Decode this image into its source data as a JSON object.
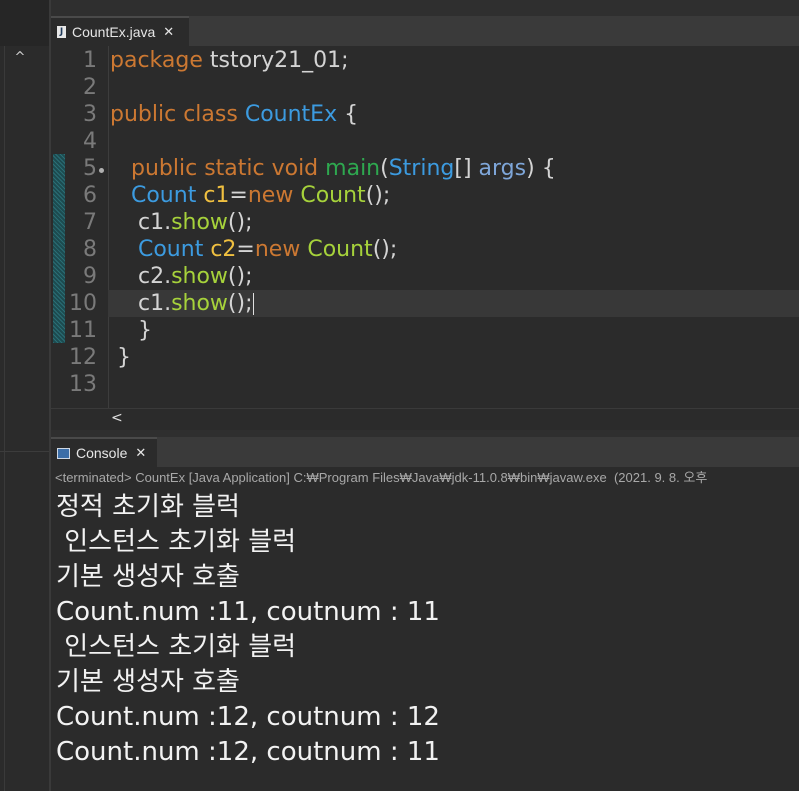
{
  "editor": {
    "tab_label": "CountEx.java",
    "file_icon": "java-file-icon",
    "close_glyph": "✕",
    "lines": [
      {
        "num": "1",
        "tokens": [
          {
            "t": "package",
            "c": "kw"
          },
          {
            "t": " tstory21_01;",
            "c": "pl"
          }
        ]
      },
      {
        "num": "2",
        "tokens": []
      },
      {
        "num": "3",
        "tokens": [
          {
            "t": "public",
            "c": "kw"
          },
          {
            "t": " ",
            "c": "pl"
          },
          {
            "t": "class",
            "c": "kw"
          },
          {
            "t": " ",
            "c": "pl"
          },
          {
            "t": "CountEx",
            "c": "cls"
          },
          {
            "t": " {",
            "c": "pl"
          }
        ]
      },
      {
        "num": "4",
        "tokens": []
      },
      {
        "num": "5",
        "tokens": [
          {
            "t": "   ",
            "c": "pl"
          },
          {
            "t": "public",
            "c": "kw"
          },
          {
            "t": " ",
            "c": "pl"
          },
          {
            "t": "static",
            "c": "kw"
          },
          {
            "t": " ",
            "c": "pl"
          },
          {
            "t": "void",
            "c": "kw"
          },
          {
            "t": " ",
            "c": "pl"
          },
          {
            "t": "main",
            "c": "fn"
          },
          {
            "t": "(",
            "c": "pl"
          },
          {
            "t": "String",
            "c": "cls"
          },
          {
            "t": "[] ",
            "c": "pl"
          },
          {
            "t": "args",
            "c": "arg"
          },
          {
            "t": ") {",
            "c": "pl"
          }
        ]
      },
      {
        "num": "6",
        "tokens": [
          {
            "t": "   ",
            "c": "pl"
          },
          {
            "t": "Count",
            "c": "cls"
          },
          {
            "t": " ",
            "c": "pl"
          },
          {
            "t": "c1",
            "c": "var"
          },
          {
            "t": "=",
            "c": "pl"
          },
          {
            "t": "new",
            "c": "kw"
          },
          {
            "t": " ",
            "c": "pl"
          },
          {
            "t": "Count",
            "c": "mth"
          },
          {
            "t": "();",
            "c": "pl"
          }
        ]
      },
      {
        "num": "7",
        "tokens": [
          {
            "t": "    c1.",
            "c": "pl"
          },
          {
            "t": "show",
            "c": "mth"
          },
          {
            "t": "();",
            "c": "pl"
          }
        ]
      },
      {
        "num": "8",
        "tokens": [
          {
            "t": "    ",
            "c": "pl"
          },
          {
            "t": "Count",
            "c": "cls"
          },
          {
            "t": " ",
            "c": "pl"
          },
          {
            "t": "c2",
            "c": "var"
          },
          {
            "t": "=",
            "c": "pl"
          },
          {
            "t": "new",
            "c": "kw"
          },
          {
            "t": " ",
            "c": "pl"
          },
          {
            "t": "Count",
            "c": "mth"
          },
          {
            "t": "();",
            "c": "pl"
          }
        ]
      },
      {
        "num": "9",
        "tokens": [
          {
            "t": "    c2.",
            "c": "pl"
          },
          {
            "t": "show",
            "c": "mth"
          },
          {
            "t": "();",
            "c": "pl"
          }
        ]
      },
      {
        "num": "10",
        "tokens": [
          {
            "t": "    c1.",
            "c": "pl"
          },
          {
            "t": "show",
            "c": "mth"
          },
          {
            "t": "();",
            "c": "pl"
          }
        ],
        "caret": true
      },
      {
        "num": "11",
        "tokens": [
          {
            "t": "    }",
            "c": "pl"
          }
        ]
      },
      {
        "num": "12",
        "tokens": [
          {
            "t": " }",
            "c": "pl"
          }
        ]
      },
      {
        "num": "13",
        "tokens": []
      }
    ],
    "scroll_left_glyph": "<"
  },
  "left_panel": {
    "scroll_up_glyph": "^"
  },
  "console": {
    "tab_label": "Console",
    "close_glyph": "✕",
    "status": "<terminated> CountEx [Java Application] C:₩Program Files₩Java₩jdk-11.0.8₩bin₩javaw.exe  (2021. 9. 8. 오후",
    "output": [
      "정적 초기화 블럭",
      " 인스턴스 초기화 블럭",
      "기본 생성자 호출",
      "Count.num :11, coutnum : 11",
      " 인스턴스 초기화 블럭",
      "기본 생성자 호출",
      "Count.num :12, coutnum : 12",
      "Count.num :12, coutnum : 11"
    ]
  },
  "colors": {
    "keyword": "#cc7832",
    "type": "#3c9be0",
    "variable": "#f0c040",
    "method": "#a6d23b",
    "main_method": "#2ea84f",
    "background": "#2b2b2b"
  }
}
